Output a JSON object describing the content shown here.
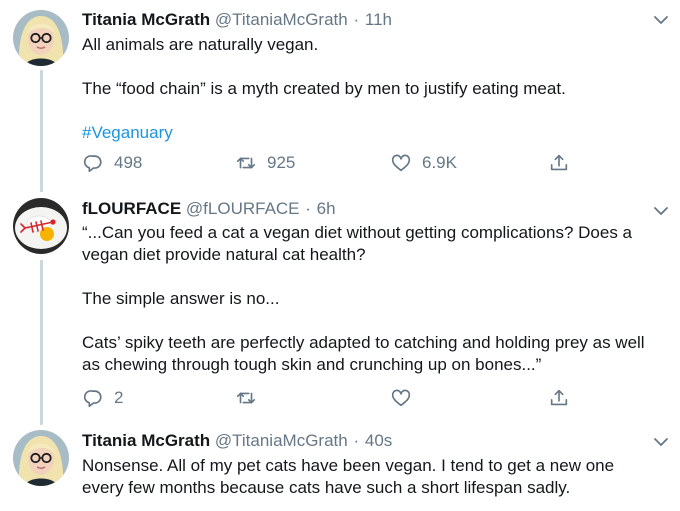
{
  "tweets": [
    {
      "name": "Titania McGrath",
      "handle": "@TitaniaMcGrath",
      "time": "11h",
      "avatar_icon": "blonde-woman-glasses-avatar",
      "paragraphs": [
        "All animals are naturally vegan.",
        "The “food chain” is a myth created by men to justify eating meat.",
        "#Veganuary"
      ],
      "reply_count": "498",
      "retweet_count": "925",
      "like_count": "6.9K"
    },
    {
      "name": "fLOURFACE",
      "handle": "@fLOURFACE",
      "time": "6h",
      "avatar_icon": "fish-skeleton-plate-avatar",
      "paragraphs": [
        "“...Can you feed a cat a vegan diet without getting complications? Does a vegan diet provide natural cat health?",
        "The simple answer is no...",
        "Cats’ spiky teeth are perfectly adapted to catching and holding prey as well as chewing through tough skin and crunching up on bones...”"
      ],
      "reply_count": "2",
      "retweet_count": "",
      "like_count": ""
    },
    {
      "name": "Titania McGrath",
      "handle": "@TitaniaMcGrath",
      "time": "40s",
      "avatar_icon": "blonde-woman-glasses-avatar",
      "paragraphs": [
        "Nonsense. All of my pet cats have been vegan. I tend to get a new one every few months because cats have such a short lifespan sadly."
      ]
    }
  ],
  "colors": {
    "text": "#14171a",
    "secondary": "#657786",
    "link": "#1b95e0",
    "thread_line": "#ccd6dd"
  }
}
